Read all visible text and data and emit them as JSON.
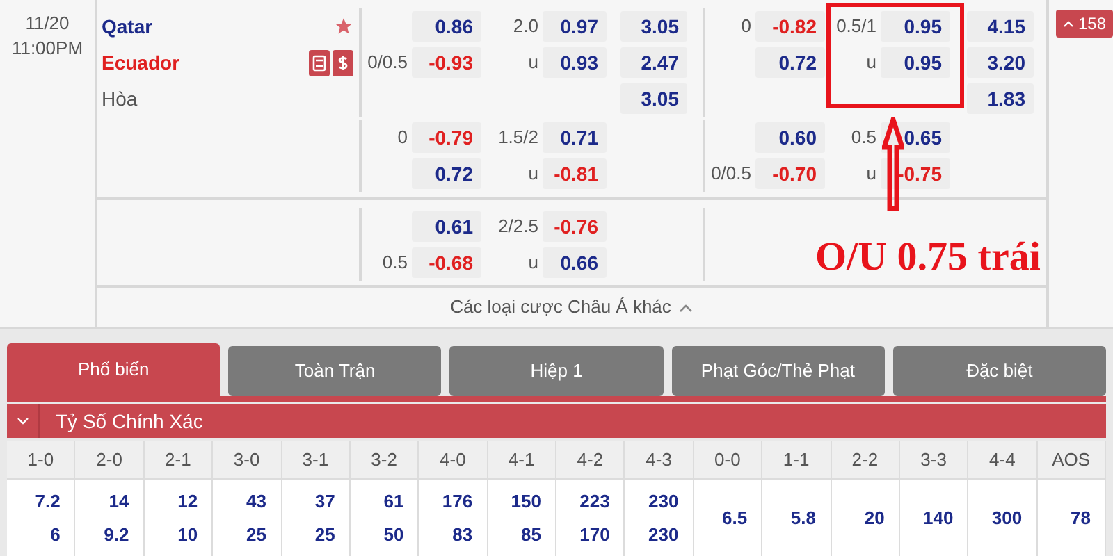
{
  "match": {
    "date": "11/20",
    "time": "11:00PM",
    "teams": [
      {
        "name": "Qatar",
        "kind": "home",
        "favorite": true
      },
      {
        "name": "Ecuador",
        "kind": "away",
        "stats_icon": true,
        "money_icon": true
      },
      {
        "name": "Hòa",
        "kind": "draw"
      }
    ],
    "more_count": "158"
  },
  "groups": [
    {
      "rows": [
        {
          "cells": [
            {
              "odds": "0.86",
              "negative": false
            },
            {
              "line": "2.0",
              "odds": "0.97",
              "negative": false
            },
            {
              "odds": "3.05",
              "negative": false
            },
            {
              "line": "0",
              "odds": "-0.82",
              "negative": true
            },
            {
              "line": "0.5/1",
              "odds": "0.95",
              "negative": false
            },
            {
              "odds": "4.15",
              "negative": false
            }
          ]
        },
        {
          "cells": [
            {
              "line": "0/0.5",
              "odds": "-0.93",
              "negative": true
            },
            {
              "line": "u",
              "odds": "0.93",
              "negative": false
            },
            {
              "odds": "2.47",
              "negative": false
            },
            {
              "odds": "0.72",
              "negative": false
            },
            {
              "line": "u",
              "odds": "0.95",
              "negative": false
            },
            {
              "odds": "3.20",
              "negative": false
            }
          ]
        },
        {
          "cells": [
            null,
            null,
            {
              "odds": "3.05",
              "negative": false
            },
            null,
            null,
            {
              "odds": "1.83",
              "negative": false
            }
          ]
        }
      ]
    },
    {
      "rows": [
        {
          "cells": [
            {
              "line": "0",
              "odds": "-0.79",
              "negative": true
            },
            {
              "line": "1.5/2",
              "odds": "0.71",
              "negative": false
            },
            null,
            {
              "odds": "0.60",
              "negative": false
            },
            {
              "line": "0.5",
              "odds": "0.65",
              "negative": false
            },
            null
          ]
        },
        {
          "cells": [
            {
              "odds": "0.72",
              "negative": false
            },
            {
              "line": "u",
              "odds": "-0.81",
              "negative": true
            },
            null,
            {
              "line": "0/0.5",
              "odds": "-0.70",
              "negative": true
            },
            {
              "line": "u",
              "odds": "-0.75",
              "negative": true
            },
            null
          ]
        }
      ]
    },
    {
      "rows": [
        {
          "cells": [
            {
              "odds": "0.61",
              "negative": false
            },
            {
              "line": "2/2.5",
              "odds": "-0.76",
              "negative": true
            },
            null,
            null,
            null,
            null
          ]
        },
        {
          "cells": [
            {
              "line": "0.5",
              "odds": "-0.68",
              "negative": true
            },
            {
              "line": "u",
              "odds": "0.66",
              "negative": false
            },
            null,
            null,
            null,
            null
          ]
        }
      ]
    }
  ],
  "more_link": "Các loại cược Châu Á khác",
  "annotation": {
    "label": "O/U 0.75 trái"
  },
  "tabs": [
    {
      "label": "Phổ biến",
      "selected": true
    },
    {
      "label": "Toàn Trận",
      "selected": false
    },
    {
      "label": "Hiệp 1",
      "selected": false
    },
    {
      "label": "Phạt Góc/Thẻ Phạt",
      "selected": false
    },
    {
      "label": "Đặc biệt",
      "selected": false
    }
  ],
  "section": {
    "title": "Tỷ Số Chính Xác",
    "expanded": true
  },
  "scores": [
    {
      "label": "1-0",
      "values": [
        "7.2",
        "6"
      ]
    },
    {
      "label": "2-0",
      "values": [
        "14",
        "9.2"
      ]
    },
    {
      "label": "2-1",
      "values": [
        "12",
        "10"
      ]
    },
    {
      "label": "3-0",
      "values": [
        "43",
        "25"
      ]
    },
    {
      "label": "3-1",
      "values": [
        "37",
        "25"
      ]
    },
    {
      "label": "3-2",
      "values": [
        "61",
        "50"
      ]
    },
    {
      "label": "4-0",
      "values": [
        "176",
        "83"
      ]
    },
    {
      "label": "4-1",
      "values": [
        "150",
        "85"
      ]
    },
    {
      "label": "4-2",
      "values": [
        "223",
        "170"
      ]
    },
    {
      "label": "4-3",
      "values": [
        "230",
        "230"
      ]
    },
    {
      "label": "0-0",
      "values": [
        "6.5"
      ]
    },
    {
      "label": "1-1",
      "values": [
        "5.8"
      ]
    },
    {
      "label": "2-2",
      "values": [
        "20"
      ]
    },
    {
      "label": "3-3",
      "values": [
        "140"
      ]
    },
    {
      "label": "4-4",
      "values": [
        "300"
      ]
    },
    {
      "label": "AOS",
      "values": [
        "78"
      ]
    }
  ]
}
